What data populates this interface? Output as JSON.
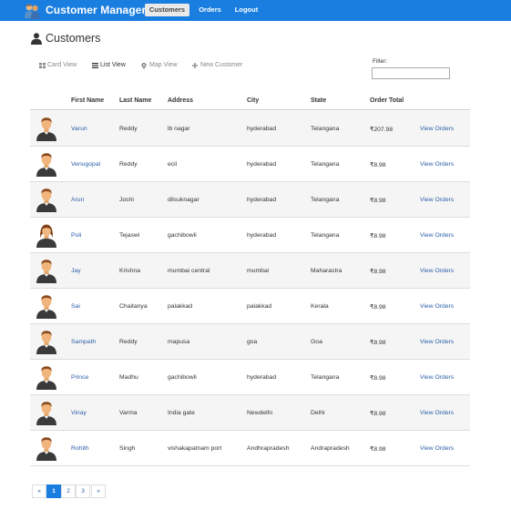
{
  "app": {
    "brand_name": "Customer Manager"
  },
  "nav": {
    "items": [
      {
        "label": "Customers",
        "active": true
      },
      {
        "label": "Orders",
        "active": false
      },
      {
        "label": "Logout",
        "active": false
      }
    ]
  },
  "page": {
    "title": "Customers"
  },
  "view_tabs": [
    {
      "label": "Card View",
      "icon": "grid-icon",
      "active": false
    },
    {
      "label": "List View",
      "icon": "list-icon",
      "active": true
    },
    {
      "label": "Map View",
      "icon": "map-marker-icon",
      "active": false
    },
    {
      "label": "New Customer",
      "icon": "plus-icon",
      "active": false
    }
  ],
  "filter": {
    "label": "Filter:",
    "value": "",
    "placeholder": ""
  },
  "table": {
    "columns": [
      "First Name",
      "Last Name",
      "Address",
      "City",
      "State",
      "Order Total"
    ],
    "view_orders_label": "View Orders",
    "rows": [
      {
        "first": "Varun",
        "last": "Reddy",
        "address": "lb nagar",
        "city": "hyderabad",
        "state": "Telangana",
        "total": "₹207.98",
        "avatar": "male"
      },
      {
        "first": "Venugopal",
        "last": "Reddy",
        "address": "ecil",
        "city": "hyderabad",
        "state": "Telangana",
        "total": "₹8.98",
        "avatar": "male"
      },
      {
        "first": "Arun",
        "last": "Joshi",
        "address": "dilsuknagar",
        "city": "hyderabad",
        "state": "Telangana",
        "total": "₹8.98",
        "avatar": "male"
      },
      {
        "first": "Puli",
        "last": "Tejaswi",
        "address": "gachibowli",
        "city": "hyderabad",
        "state": "Telangana",
        "total": "₹8.98",
        "avatar": "female"
      },
      {
        "first": "Jay",
        "last": "Krishna",
        "address": "mumbai central",
        "city": "mumbai",
        "state": "Maharastra",
        "total": "₹8.98",
        "avatar": "male"
      },
      {
        "first": "Sai",
        "last": "Chaitanya",
        "address": "palakkad",
        "city": "palakkad",
        "state": "Kerala",
        "total": "₹8.98",
        "avatar": "male"
      },
      {
        "first": "Sampath",
        "last": "Reddy",
        "address": "mapusa",
        "city": "goa",
        "state": "Goa",
        "total": "₹8.98",
        "avatar": "male"
      },
      {
        "first": "Prince",
        "last": "Madhu",
        "address": "gachibowli",
        "city": "hyderabad",
        "state": "Telangana",
        "total": "₹8.98",
        "avatar": "male"
      },
      {
        "first": "Vinay",
        "last": "Varma",
        "address": "India gate",
        "city": "Newdelhi",
        "state": "Delhi",
        "total": "₹8.98",
        "avatar": "male"
      },
      {
        "first": "Rohith",
        "last": "Singh",
        "address": "vishakapatnam port",
        "city": "Andhrapradesh",
        "state": "Andrapradesh",
        "total": "₹8.98",
        "avatar": "male"
      }
    ]
  },
  "pagination": {
    "prev": "«",
    "pages": [
      "1",
      "2",
      "3"
    ],
    "active_page": "1",
    "next": "»"
  },
  "colors": {
    "navbar": "#1a7ee0",
    "link": "#2a5ea8",
    "row_stripe": "#f5f5f5"
  }
}
